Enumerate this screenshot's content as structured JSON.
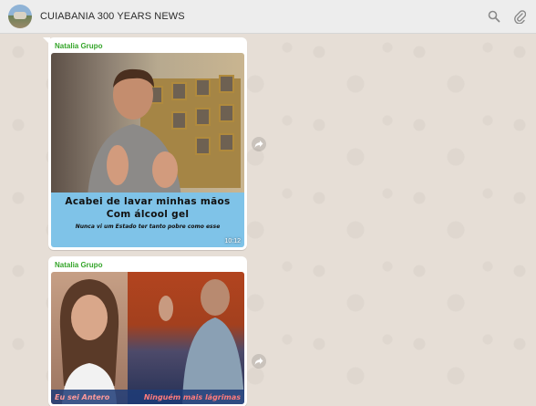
{
  "header": {
    "title": "CUIABANIA 300 YEARS NEWS",
    "icons": [
      "search-icon",
      "paperclip-icon"
    ]
  },
  "messages": [
    {
      "sender": "Natalia Grupo",
      "caption_line1": "Acabei de lavar minhas mãos",
      "caption_line2": "Com álcool gel",
      "caption_line3": "Nunca vi um Estado ter tanto pobre como esse",
      "time": "10:12"
    },
    {
      "sender": "Natalia Grupo",
      "caption_left": "Eu sei Antero",
      "caption_right": "Ninguém mais lágrimas"
    }
  ],
  "colors": {
    "header_bg": "#ededed",
    "chat_bg": "#e5ddd5",
    "sender_name": "#35a52a",
    "caption_bg": "#7fc3e8"
  }
}
